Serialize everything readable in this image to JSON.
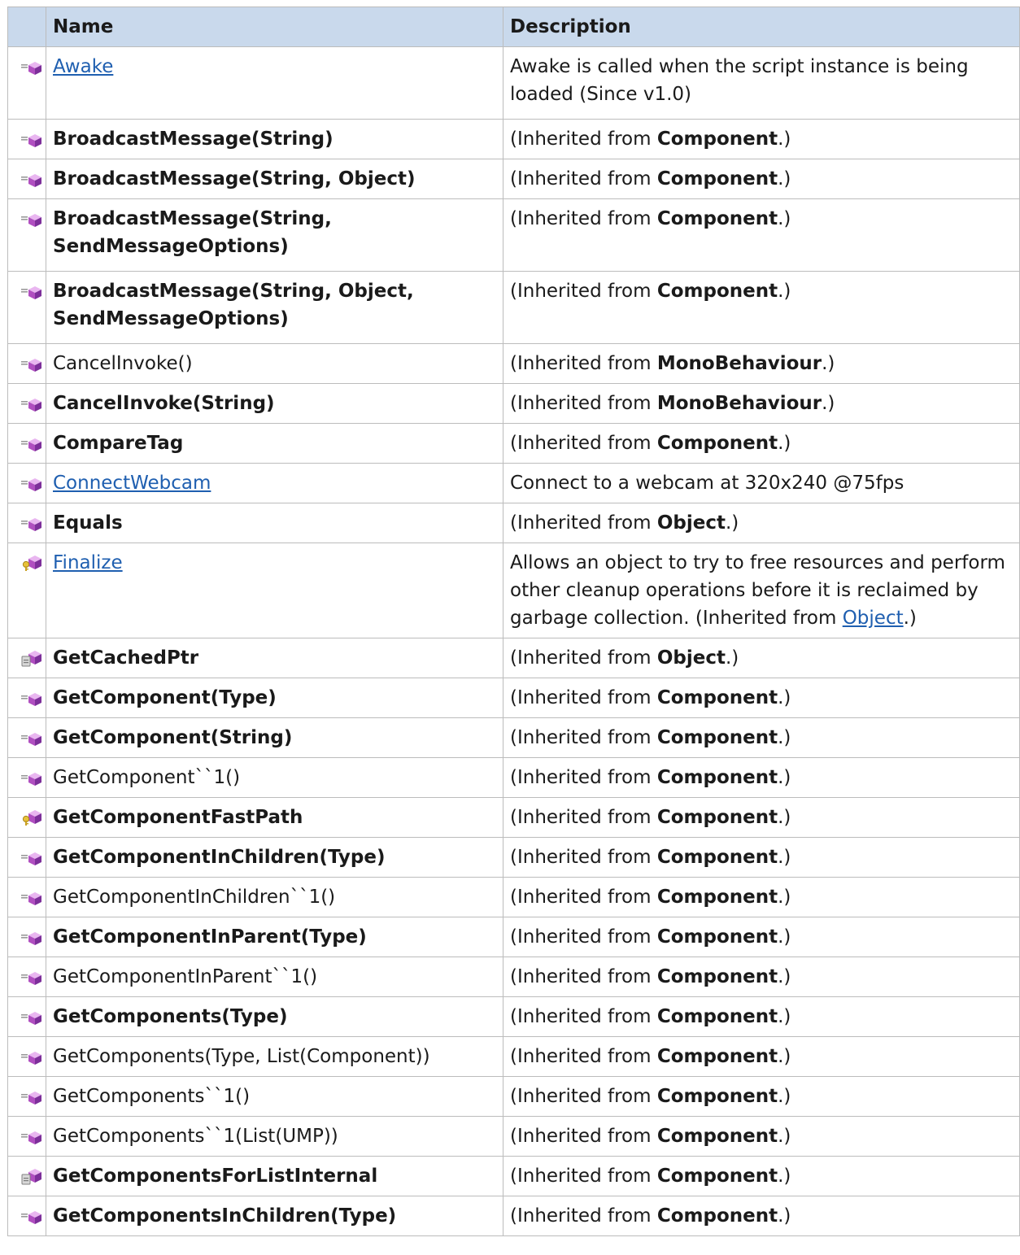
{
  "header": {
    "name": "Name",
    "description": "Description"
  },
  "rows": [
    {
      "name": "Awake",
      "style": "link",
      "icon": "public-method-icon",
      "desc": [
        {
          "t": "Awake is called when the script instance is being loaded (Since v1.0)"
        }
      ]
    },
    {
      "name": "BroadcastMessage(String)",
      "style": "bold",
      "icon": "public-method-icon",
      "desc": [
        {
          "t": " (Inherited from "
        },
        {
          "t": "Component",
          "b": true
        },
        {
          "t": ".)"
        }
      ]
    },
    {
      "name": "BroadcastMessage(String, Object)",
      "style": "bold",
      "icon": "public-method-icon",
      "desc": [
        {
          "t": " (Inherited from "
        },
        {
          "t": "Component",
          "b": true
        },
        {
          "t": ".)"
        }
      ]
    },
    {
      "name": "BroadcastMessage(String, SendMessageOptions)",
      "style": "bold",
      "icon": "public-method-icon",
      "desc": [
        {
          "t": " (Inherited from "
        },
        {
          "t": "Component",
          "b": true
        },
        {
          "t": ".)"
        }
      ]
    },
    {
      "name": "BroadcastMessage(String, Object, SendMessageOptions)",
      "style": "bold",
      "icon": "public-method-icon",
      "desc": [
        {
          "t": " (Inherited from "
        },
        {
          "t": "Component",
          "b": true
        },
        {
          "t": ".)"
        }
      ]
    },
    {
      "name": "CancelInvoke()",
      "style": "plain",
      "icon": "public-method-icon",
      "desc": [
        {
          "t": " (Inherited from "
        },
        {
          "t": "MonoBehaviour",
          "b": true
        },
        {
          "t": ".)"
        }
      ]
    },
    {
      "name": "CancelInvoke(String)",
      "style": "bold",
      "icon": "public-method-icon",
      "desc": [
        {
          "t": " (Inherited from "
        },
        {
          "t": "MonoBehaviour",
          "b": true
        },
        {
          "t": ".)"
        }
      ]
    },
    {
      "name": "CompareTag",
      "style": "bold",
      "icon": "public-method-icon",
      "desc": [
        {
          "t": " (Inherited from "
        },
        {
          "t": "Component",
          "b": true
        },
        {
          "t": ".)"
        }
      ]
    },
    {
      "name": "ConnectWebcam",
      "style": "link",
      "icon": "public-method-icon",
      "desc": [
        {
          "t": "Connect to a webcam at 320x240 @75fps"
        }
      ]
    },
    {
      "name": "Equals",
      "style": "bold",
      "icon": "public-method-icon",
      "desc": [
        {
          "t": " (Inherited from "
        },
        {
          "t": "Object",
          "b": true
        },
        {
          "t": ".)"
        }
      ]
    },
    {
      "name": "Finalize",
      "style": "link",
      "icon": "protected-method-icon",
      "desc": [
        {
          "t": "Allows an object to try to free resources and perform other cleanup operations before it is reclaimed by garbage collection. (Inherited from "
        },
        {
          "t": "Object",
          "link": true
        },
        {
          "t": ".)"
        }
      ]
    },
    {
      "name": "GetCachedPtr",
      "style": "bold",
      "icon": "internal-method-icon",
      "desc": [
        {
          "t": " (Inherited from "
        },
        {
          "t": "Object",
          "b": true
        },
        {
          "t": ".)"
        }
      ]
    },
    {
      "name": "GetComponent(Type)",
      "style": "bold",
      "icon": "public-method-icon",
      "desc": [
        {
          "t": " (Inherited from "
        },
        {
          "t": "Component",
          "b": true
        },
        {
          "t": ".)"
        }
      ]
    },
    {
      "name": "GetComponent(String)",
      "style": "bold",
      "icon": "public-method-icon",
      "desc": [
        {
          "t": " (Inherited from "
        },
        {
          "t": "Component",
          "b": true
        },
        {
          "t": ".)"
        }
      ]
    },
    {
      "name": "GetComponent``1()",
      "style": "plain",
      "icon": "public-method-icon",
      "desc": [
        {
          "t": " (Inherited from "
        },
        {
          "t": "Component",
          "b": true
        },
        {
          "t": ".)"
        }
      ]
    },
    {
      "name": "GetComponentFastPath",
      "style": "bold",
      "icon": "protected-method-icon",
      "desc": [
        {
          "t": " (Inherited from "
        },
        {
          "t": "Component",
          "b": true
        },
        {
          "t": ".)"
        }
      ]
    },
    {
      "name": "GetComponentInChildren(Type)",
      "style": "bold",
      "icon": "public-method-icon",
      "desc": [
        {
          "t": " (Inherited from "
        },
        {
          "t": "Component",
          "b": true
        },
        {
          "t": ".)"
        }
      ]
    },
    {
      "name": "GetComponentInChildren``1()",
      "style": "plain",
      "icon": "public-method-icon",
      "desc": [
        {
          "t": " (Inherited from "
        },
        {
          "t": "Component",
          "b": true
        },
        {
          "t": ".)"
        }
      ]
    },
    {
      "name": "GetComponentInParent(Type)",
      "style": "bold",
      "icon": "public-method-icon",
      "desc": [
        {
          "t": " (Inherited from "
        },
        {
          "t": "Component",
          "b": true
        },
        {
          "t": ".)"
        }
      ]
    },
    {
      "name": "GetComponentInParent``1()",
      "style": "plain",
      "icon": "public-method-icon",
      "desc": [
        {
          "t": " (Inherited from "
        },
        {
          "t": "Component",
          "b": true
        },
        {
          "t": ".)"
        }
      ]
    },
    {
      "name": "GetComponents(Type)",
      "style": "bold",
      "icon": "public-method-icon",
      "desc": [
        {
          "t": " (Inherited from "
        },
        {
          "t": "Component",
          "b": true
        },
        {
          "t": ".)"
        }
      ]
    },
    {
      "name": "GetComponents(Type, List(Component))",
      "style": "plain",
      "icon": "public-method-icon",
      "desc": [
        {
          "t": " (Inherited from "
        },
        {
          "t": "Component",
          "b": true
        },
        {
          "t": ".)"
        }
      ]
    },
    {
      "name": "GetComponents``1()",
      "style": "plain",
      "icon": "public-method-icon",
      "desc": [
        {
          "t": " (Inherited from "
        },
        {
          "t": "Component",
          "b": true
        },
        {
          "t": ".)"
        }
      ]
    },
    {
      "name": "GetComponents``1(List(UMP))",
      "style": "plain",
      "icon": "public-method-icon",
      "desc": [
        {
          "t": " (Inherited from "
        },
        {
          "t": "Component",
          "b": true
        },
        {
          "t": ".)"
        }
      ]
    },
    {
      "name": "GetComponentsForListInternal",
      "style": "bold",
      "icon": "internal-method-icon",
      "desc": [
        {
          "t": " (Inherited from "
        },
        {
          "t": "Component",
          "b": true
        },
        {
          "t": ".)"
        }
      ]
    },
    {
      "name": "GetComponentsInChildren(Type)",
      "style": "bold",
      "icon": "public-method-icon",
      "desc": [
        {
          "t": " (Inherited from "
        },
        {
          "t": "Component",
          "b": true
        },
        {
          "t": ".)"
        }
      ]
    }
  ]
}
